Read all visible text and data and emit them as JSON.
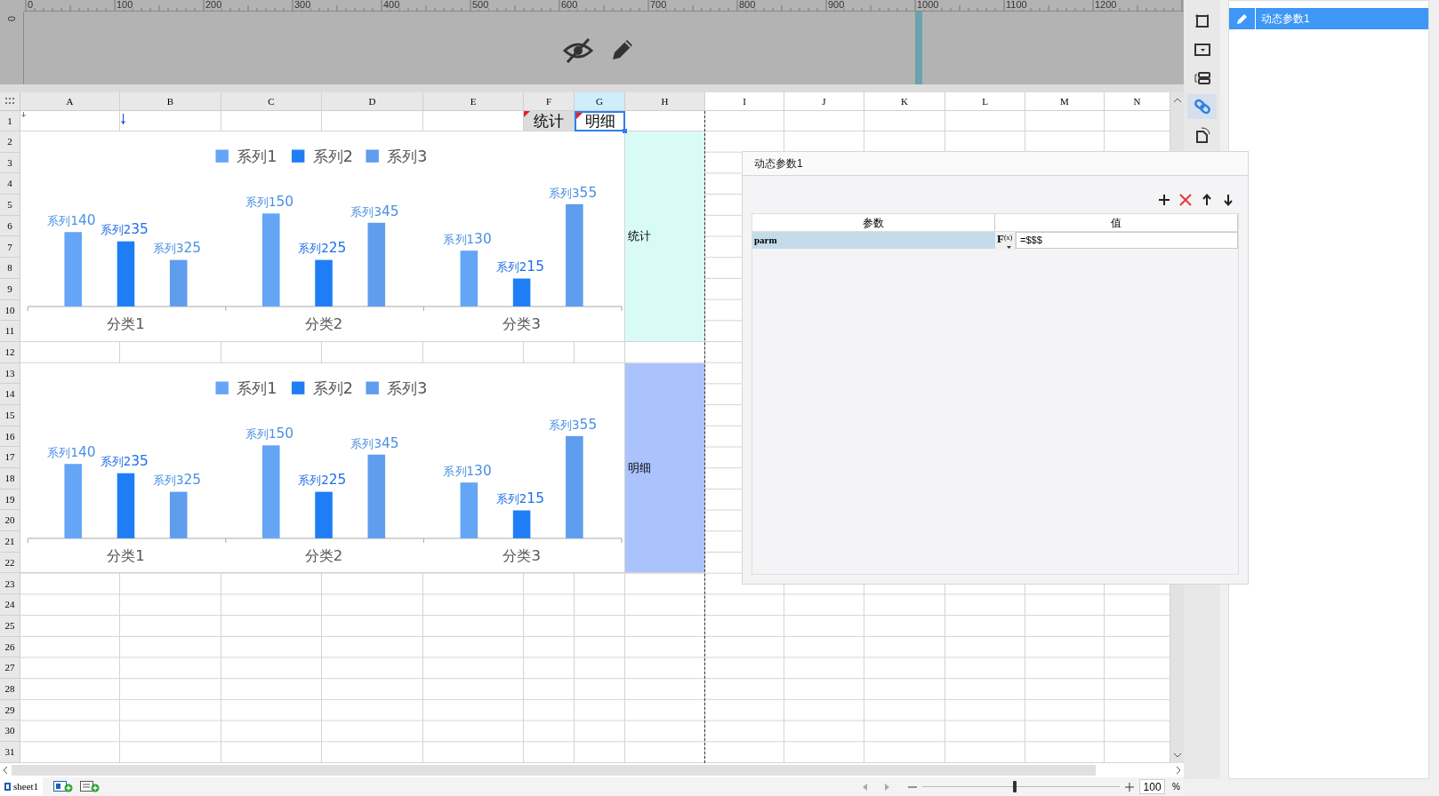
{
  "ruler": {
    "ticks": [
      "0",
      "100",
      "200",
      "300",
      "400",
      "500",
      "600",
      "700",
      "800",
      "900",
      "1000",
      "1100",
      "1200"
    ],
    "vertical_ticks": [
      "0"
    ]
  },
  "sheet": {
    "columns": [
      {
        "label": "A",
        "selected": false
      },
      {
        "label": "B",
        "selected": false
      },
      {
        "label": "C",
        "selected": false
      },
      {
        "label": "D",
        "selected": false
      },
      {
        "label": "E",
        "selected": false
      },
      {
        "label": "F",
        "selected": false
      },
      {
        "label": "G",
        "selected": true
      },
      {
        "label": "H",
        "selected": false
      },
      {
        "label": "I",
        "selected": false
      },
      {
        "label": "J",
        "selected": false
      },
      {
        "label": "K",
        "selected": false
      },
      {
        "label": "L",
        "selected": false
      },
      {
        "label": "M",
        "selected": false
      },
      {
        "label": "N",
        "selected": false
      }
    ],
    "rows": [
      "1",
      "2",
      "3",
      "4",
      "5",
      "6",
      "7",
      "8",
      "9",
      "10",
      "11",
      "12",
      "13",
      "14",
      "15",
      "16",
      "17",
      "18",
      "19",
      "20",
      "21",
      "22",
      "23",
      "24",
      "25",
      "26",
      "27",
      "28",
      "29",
      "30",
      "31"
    ],
    "header_cells": [
      {
        "text": "统计",
        "selected": false,
        "flagged": true
      },
      {
        "text": "明细",
        "selected": true,
        "flagged": true
      }
    ],
    "blocks": [
      {
        "label": "统计",
        "color": "#d8fbf6",
        "chart_data": {
          "type": "bar",
          "legend": "top",
          "categories": [
            "分类1",
            "分类2",
            "分类3"
          ],
          "series": [
            {
              "name": "系列1",
              "color": "#64a5f6",
              "values": [
                40,
                50,
                30
              ]
            },
            {
              "name": "系列2",
              "color": "#1f7ef5",
              "values": [
                35,
                25,
                15
              ]
            },
            {
              "name": "系列3",
              "color": "#5f9dee",
              "values": [
                25,
                45,
                55
              ]
            }
          ],
          "data_labels": true
        }
      },
      {
        "label": "明细",
        "color": "#abc3fd",
        "chart_data": {
          "type": "bar",
          "legend": "top",
          "categories": [
            "分类1",
            "分类2",
            "分类3"
          ],
          "series": [
            {
              "name": "系列1",
              "color": "#64a5f6",
              "values": [
                40,
                50,
                30
              ]
            },
            {
              "name": "系列2",
              "color": "#1f7ef5",
              "values": [
                35,
                25,
                15
              ]
            },
            {
              "name": "系列3",
              "color": "#5f9dee",
              "values": [
                25,
                45,
                55
              ]
            }
          ],
          "data_labels": true
        }
      }
    ]
  },
  "dialog": {
    "title": "动态参数1",
    "columns": [
      "参数",
      "值"
    ],
    "rows": [
      {
        "name": "parm",
        "formula": "F",
        "formula_suffix": "(x)",
        "value": "=$$$",
        "selected": true
      }
    ]
  },
  "tools": [
    {
      "kind": "frame",
      "selected": false
    },
    {
      "kind": "dropdown",
      "selected": false
    },
    {
      "kind": "stack",
      "selected": false
    },
    {
      "kind": "link",
      "selected": true
    },
    {
      "kind": "rotate",
      "selected": false
    }
  ],
  "panel": {
    "items": [
      {
        "label": "动态参数1",
        "selected": true
      }
    ]
  },
  "bottom_bar": {
    "sheets": [
      {
        "label": "sheet1",
        "selected": true
      }
    ],
    "zoom": {
      "level": 0.47,
      "value": "100",
      "unit": "%"
    }
  }
}
